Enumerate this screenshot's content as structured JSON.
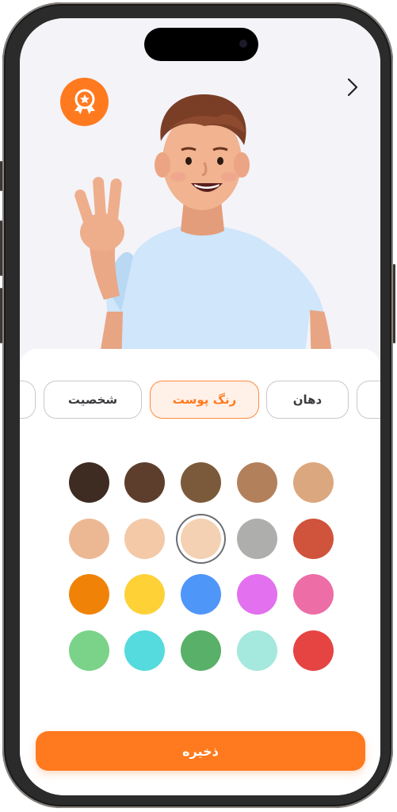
{
  "colors": {
    "accent": "#ff7a1f",
    "accent_tint": "#fff1e8",
    "hero_bg": "#f4f3f8"
  },
  "header": {
    "badge_icon": "award-ribbon-icon",
    "back_icon": "chevron-right-icon"
  },
  "tabs": [
    {
      "label": "",
      "icon": "tab-partial-left"
    },
    {
      "label": "شخصیت"
    },
    {
      "label": "رنگ پوست",
      "active": true
    },
    {
      "label": "دهان"
    },
    {
      "label": "",
      "icon": "tab-partial-right"
    }
  ],
  "swatches": [
    [
      "#3e2c22",
      "#5d3e2c",
      "#7b5a3b",
      "#b3805c",
      "#dba77e"
    ],
    [
      "#ecb894",
      "#f3c9a8",
      "#f4d1b3",
      "#aeafac",
      "#d0533b"
    ],
    [
      "#f08307",
      "#fed237",
      "#4f96f9",
      "#e370ee",
      "#ed6da6"
    ],
    [
      "#7bd289",
      "#55dbdd",
      "#59b068",
      "#a5e8dd",
      "#e64343"
    ]
  ],
  "selected_swatch": {
    "row": 1,
    "col": 2
  },
  "save": {
    "label": "ذخیره"
  }
}
